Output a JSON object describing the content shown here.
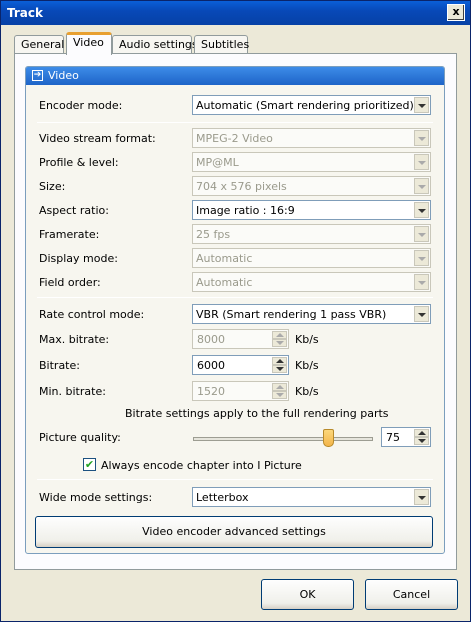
{
  "window": {
    "title": "Track",
    "close_glyph": "x"
  },
  "tabs": [
    {
      "label": "General"
    },
    {
      "label": "Video",
      "active": true
    },
    {
      "label": "Audio settings"
    },
    {
      "label": "Subtitles"
    }
  ],
  "group": {
    "title": "Video",
    "icon": "arrow-right-icon"
  },
  "fields": {
    "encoder_mode": {
      "label": "Encoder mode:",
      "value": "Automatic (Smart rendering prioritized)"
    },
    "video_stream_format": {
      "label": "Video stream format:",
      "value": "MPEG-2 Video"
    },
    "profile_level": {
      "label": "Profile & level:",
      "value": "MP@ML"
    },
    "size": {
      "label": "Size:",
      "value": "704 x 576 pixels"
    },
    "aspect_ratio": {
      "label": "Aspect ratio:",
      "value": "Image ratio : 16:9"
    },
    "framerate": {
      "label": "Framerate:",
      "value": "25  fps"
    },
    "display_mode": {
      "label": "Display mode:",
      "value": "Automatic"
    },
    "field_order": {
      "label": "Field order:",
      "value": "Automatic"
    },
    "rate_control_mode": {
      "label": "Rate control mode:",
      "value": "VBR (Smart rendering 1 pass VBR)"
    },
    "max_bitrate": {
      "label": "Max. bitrate:",
      "value": "8000",
      "unit": "Kb/s"
    },
    "bitrate": {
      "label": "Bitrate:",
      "value": "6000",
      "unit": "Kb/s"
    },
    "min_bitrate": {
      "label": "Min. bitrate:",
      "value": "1520",
      "unit": "Kb/s"
    },
    "bitrate_note": "Bitrate settings apply to the full rendering parts",
    "picture_quality": {
      "label": "Picture quality:",
      "value": "75",
      "slider_fraction": 0.75
    },
    "always_encode": {
      "label": "Always encode chapter into I Picture",
      "checked": true,
      "check_glyph": "✔"
    },
    "wide_mode": {
      "label": "Wide mode settings:",
      "value": "Letterbox"
    }
  },
  "advanced_button": "Video encoder advanced settings",
  "buttons": {
    "ok": "OK",
    "cancel": "Cancel"
  }
}
